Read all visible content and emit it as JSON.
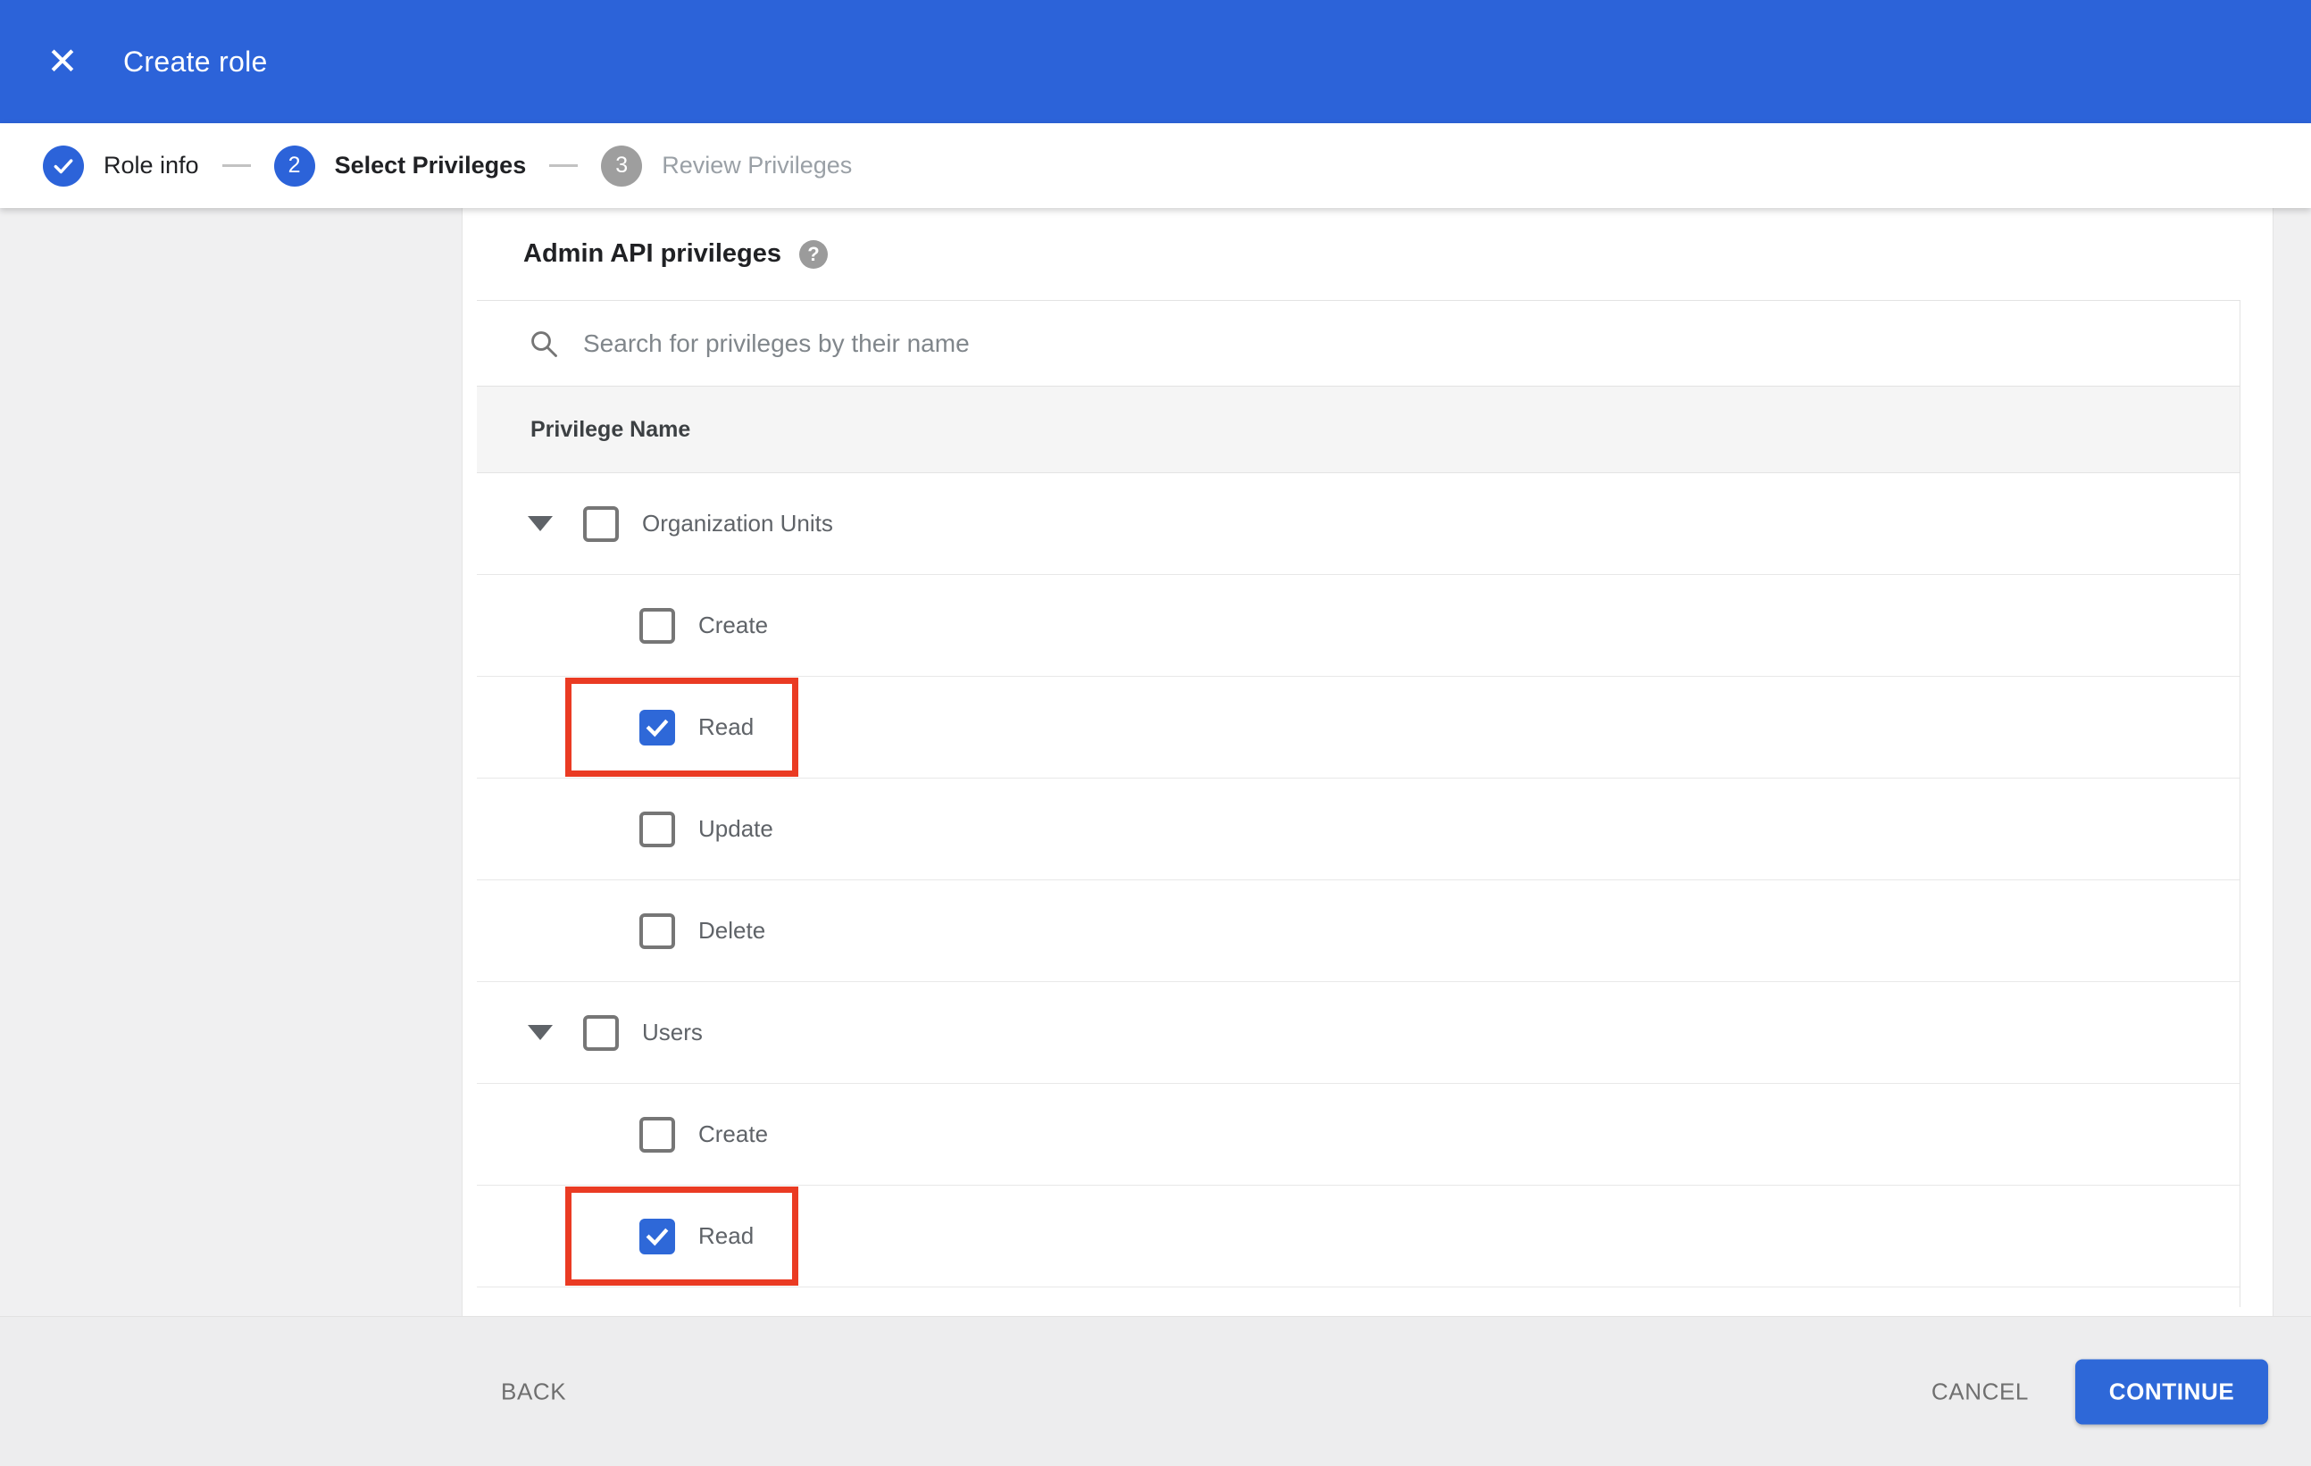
{
  "app_bar": {
    "title": "Create role",
    "close_glyph": "✕"
  },
  "stepper": {
    "steps": [
      {
        "number": "1",
        "label": "Role info",
        "state": "completed"
      },
      {
        "number": "2",
        "label": "Select Privileges",
        "state": "active"
      },
      {
        "number": "3",
        "label": "Review Privileges",
        "state": "upcoming"
      }
    ]
  },
  "content": {
    "section_title": "Admin API privileges",
    "help_glyph": "?",
    "search_placeholder": "Search for privileges by their name",
    "table_header": "Privilege Name",
    "groups": [
      {
        "label": "Organization Units",
        "checked": false,
        "privileges": [
          {
            "label": "Create",
            "checked": false,
            "highlighted": false
          },
          {
            "label": "Read",
            "checked": true,
            "highlighted": true
          },
          {
            "label": "Update",
            "checked": false,
            "highlighted": false
          },
          {
            "label": "Delete",
            "checked": false,
            "highlighted": false
          }
        ]
      },
      {
        "label": "Users",
        "checked": false,
        "privileges": [
          {
            "label": "Create",
            "checked": false,
            "highlighted": false
          },
          {
            "label": "Read",
            "checked": true,
            "highlighted": true
          }
        ]
      }
    ]
  },
  "footer": {
    "back_label": "BACK",
    "cancel_label": "CANCEL",
    "continue_label": "CONTINUE"
  },
  "colors": {
    "app_bar_blue": "#2c63d9",
    "accent_blue": "#2e68d8",
    "highlight_red": "#ea3b23"
  }
}
